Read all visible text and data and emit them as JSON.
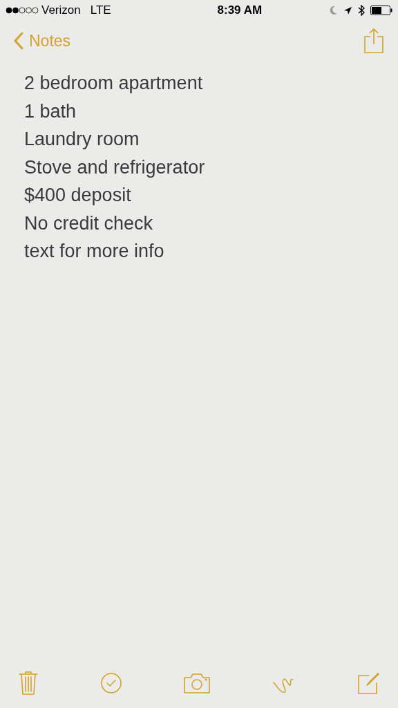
{
  "status_bar": {
    "carrier": "Verizon",
    "network": "LTE",
    "time": "8:39 AM"
  },
  "nav": {
    "back_label": "Notes"
  },
  "note": {
    "lines": [
      "2 bedroom apartment",
      "1 bath",
      "Laundry room",
      "Stove and refrigerator",
      "$400 deposit",
      "No credit check",
      "text for more info"
    ]
  },
  "toolbar": [
    {
      "kind": "trash"
    },
    {
      "kind": "check"
    },
    {
      "kind": "camera"
    },
    {
      "kind": "sketch"
    },
    {
      "kind": "compose"
    }
  ]
}
